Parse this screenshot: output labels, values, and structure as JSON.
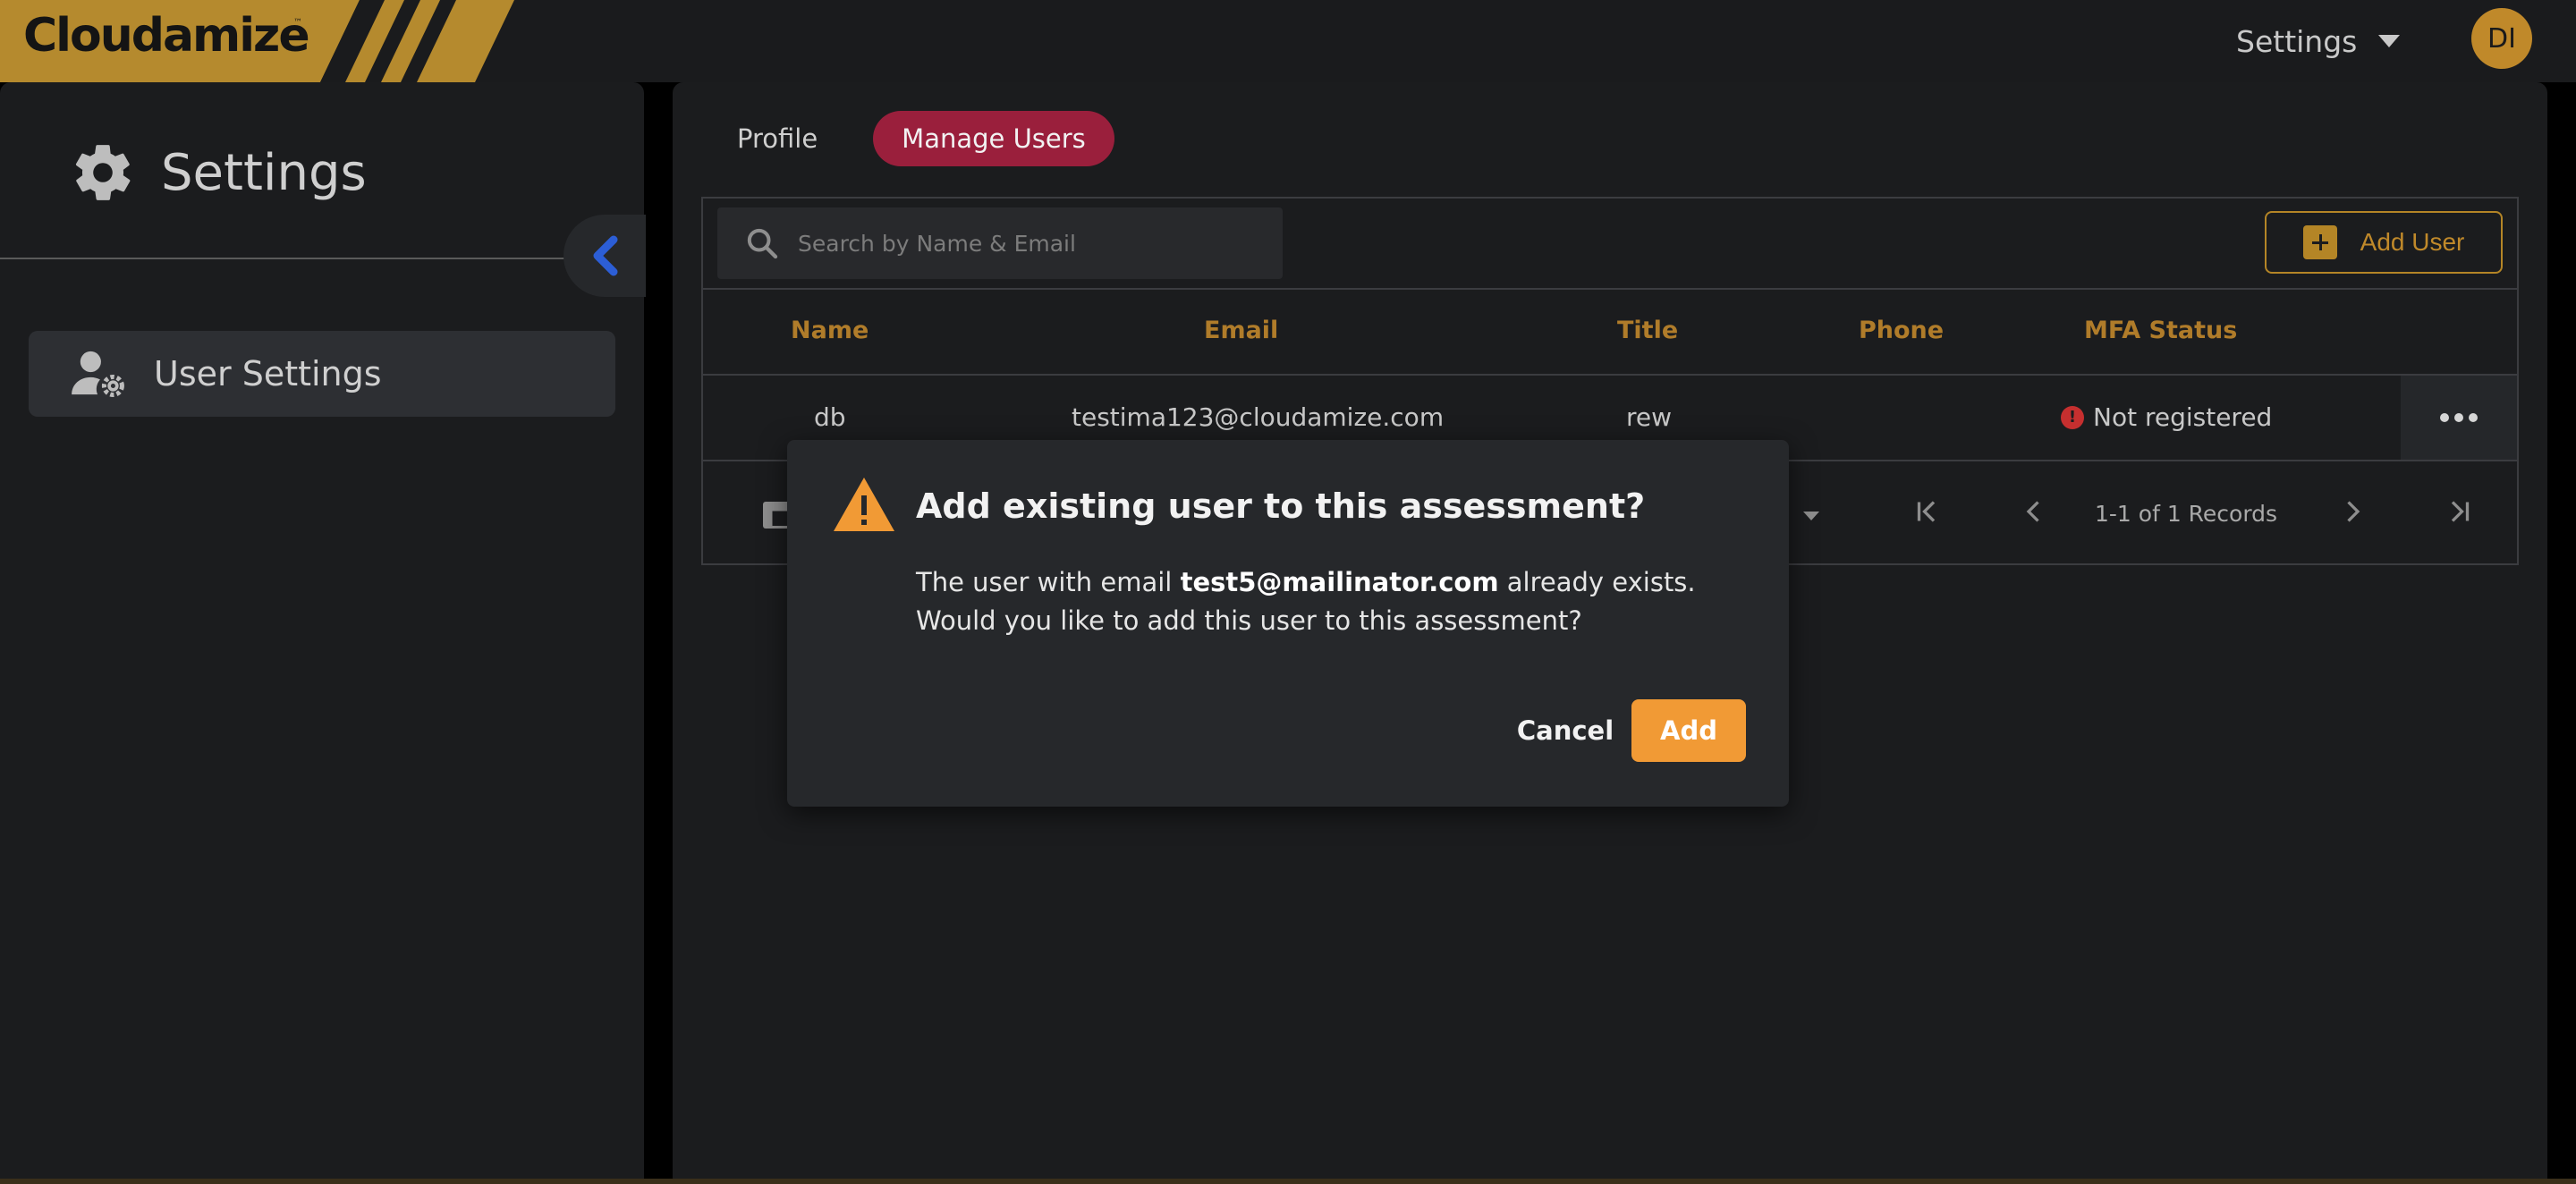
{
  "header": {
    "logo_text": "Cloudamize",
    "logo_tm": "™",
    "settings_menu_label": "Settings",
    "avatar_initials": "DI"
  },
  "sidebar": {
    "title": "Settings",
    "items": [
      {
        "label": "User Settings",
        "icon": "user-gear-icon"
      }
    ]
  },
  "main": {
    "tabs": [
      {
        "label": "Profile",
        "active": false
      },
      {
        "label": "Manage Users",
        "active": true
      }
    ],
    "search": {
      "placeholder": "Search by Name & Email",
      "value": ""
    },
    "add_user_label": "Add User",
    "table": {
      "columns": [
        "Name",
        "Email",
        "Title",
        "Phone",
        "MFA Status"
      ],
      "rows": [
        {
          "name": "db",
          "email": "testima123@cloudamize.com",
          "title": "rew",
          "phone": "",
          "mfa_status": "Not registered"
        }
      ]
    },
    "pagination": {
      "records_text": "1-1 of 1 Records"
    }
  },
  "modal": {
    "title": "Add existing user to this assessment?",
    "body_prefix": "The user with email ",
    "email": "test5@mailinator.com",
    "body_suffix": " already exists. Would you like to add this user to this assessment?",
    "cancel_label": "Cancel",
    "add_label": "Add"
  },
  "colors": {
    "accent_gold": "#b48526",
    "active_tab": "#9a1f3c",
    "modal_add_button": "#f19a35",
    "error_red": "#c62f2f",
    "collapse_chevron": "#2c5ed6"
  }
}
